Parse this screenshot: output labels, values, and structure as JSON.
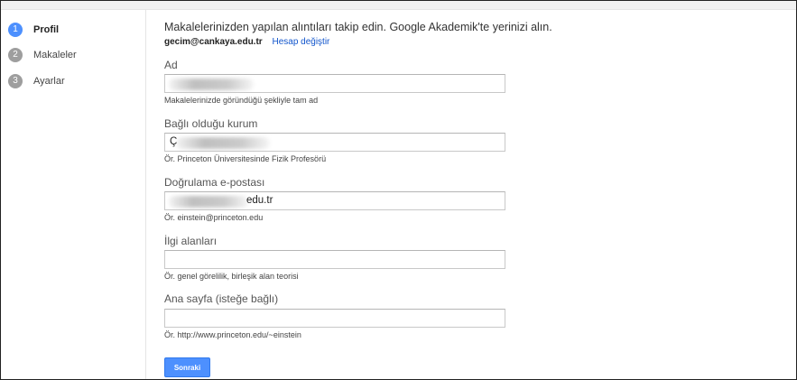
{
  "steps": [
    {
      "num": "1",
      "label": "Profil",
      "active": true
    },
    {
      "num": "2",
      "label": "Makaleler",
      "active": false
    },
    {
      "num": "3",
      "label": "Ayarlar",
      "active": false
    }
  ],
  "intro": "Makalelerinizden yapılan alıntıları takip edin. Google Akademik'te yerinizi alın.",
  "account": {
    "email": "gecim@cankaya.edu.tr",
    "change_link": "Hesap değiştir"
  },
  "fields": {
    "name": {
      "label": "Ad",
      "value": "",
      "hint": "Makalelerinizde göründüğü şekliyle tam ad"
    },
    "affiliation": {
      "label": "Bağlı olduğu kurum",
      "value": "Ç",
      "hint": "Ör. Princeton Üniversitesinde Fizik Profesörü"
    },
    "email": {
      "label": "Doğrulama e-postası",
      "value": "edu.tr",
      "hint": "Ör. einstein@princeton.edu"
    },
    "interests": {
      "label": "İlgi alanları",
      "value": "",
      "hint": "Ör. genel görelilik, birleşik alan teorisi"
    },
    "homepage": {
      "label": "Ana sayfa (isteğe bağlı)",
      "value": "",
      "hint": "Ör. http://www.princeton.edu/~einstein"
    }
  },
  "next_button": "Sonraki",
  "colors": {
    "accent": "#4d90fe",
    "link": "#1155cc",
    "step_inactive": "#9e9e9e"
  }
}
